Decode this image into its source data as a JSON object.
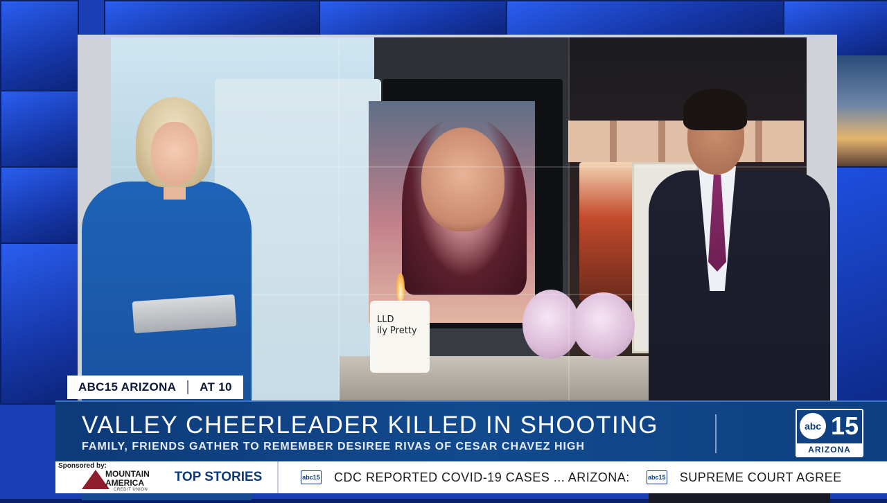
{
  "tags": {
    "station": "ABC15 ARIZONA",
    "time": "AT 10"
  },
  "lower_third": {
    "headline": "VALLEY CHEERLEADER KILLED IN SHOOTING",
    "subhead": "FAMILY, FRIENDS GATHER TO REMEMBER DESIREE RIVAS OF CESAR CHAVEZ HIGH"
  },
  "logo": {
    "network": "abc",
    "number": "15",
    "location": "ARIZONA"
  },
  "ticker": {
    "sponsored_by": "Sponsored by:",
    "sponsor_name_line1": "MOUNTAIN",
    "sponsor_name_line2": "AMERICA",
    "sponsor_sub": "CREDIT UNION",
    "section_label": "TOP STORIES",
    "item_logo": "abc15",
    "items": [
      "CDC REPORTED COVID-19 CASES ... ARIZONA:",
      "SUPREME COURT AGREE"
    ]
  },
  "candle_text": {
    "line1": "LLD",
    "line2": "ily Pretty"
  },
  "colors": {
    "brand_blue": "#0d3a78",
    "lower_third_bg": "#124a8f",
    "studio_blue": "#1a3fb5"
  }
}
